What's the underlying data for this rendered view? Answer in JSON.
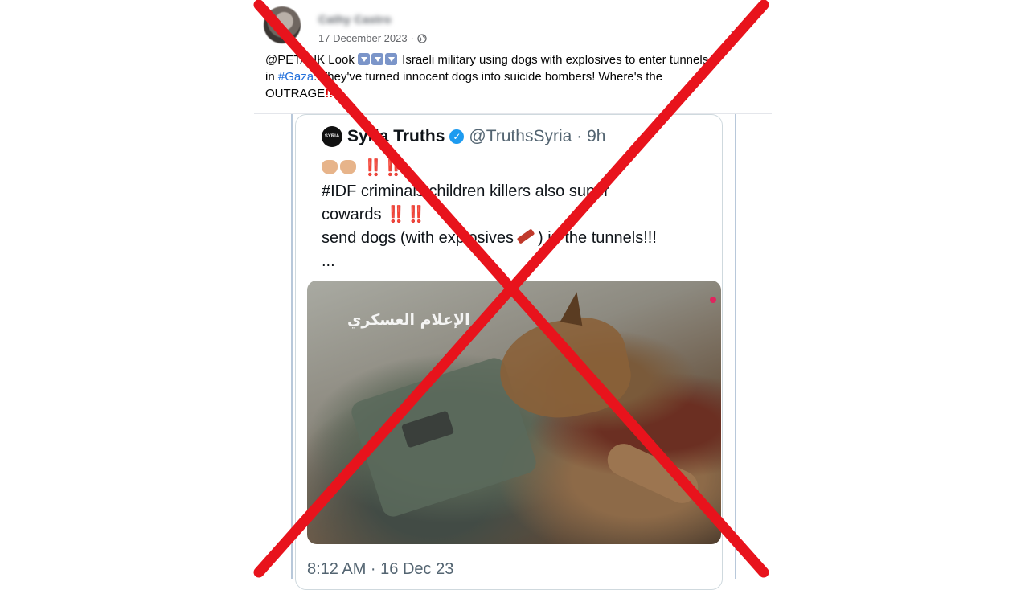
{
  "post": {
    "author": "Cathy Castro",
    "date": "17 December 2023",
    "separator": "·",
    "more_label": "...",
    "text_line1_before_icons": "@PETAUK Look",
    "text_line1_after_icons": "Israeli military using dogs with explosives to enter tunnels",
    "text_line2_prefix": "in",
    "hashtag": "#Gaza",
    "text_line2_after_tag": ". They've turned innocent dogs into suicide bombers! Where's the",
    "text_line3": "OUTRAGE",
    "text_line3_mark": "!!"
  },
  "tweet": {
    "logo_text": "SYRIA",
    "name": "Syria Truths",
    "handle": "@TruthsSyria",
    "age": "· 9h",
    "bangs1": "‼️‼️",
    "line2": "#IDF criminals children killers also super",
    "line3_text": "cowards",
    "line3_bangs": "‼️‼️",
    "line4_before": "send dogs (with explosives",
    "line4_after": ") in the tunnels!!!",
    "ellipsis": "...",
    "watermark": "الإعلام العسكري",
    "timestamp": "8:12 AM · 16 Dec 23"
  },
  "colors": {
    "cross": "#e8131c",
    "link": "#216fdb",
    "verified": "#1d9bf0"
  }
}
